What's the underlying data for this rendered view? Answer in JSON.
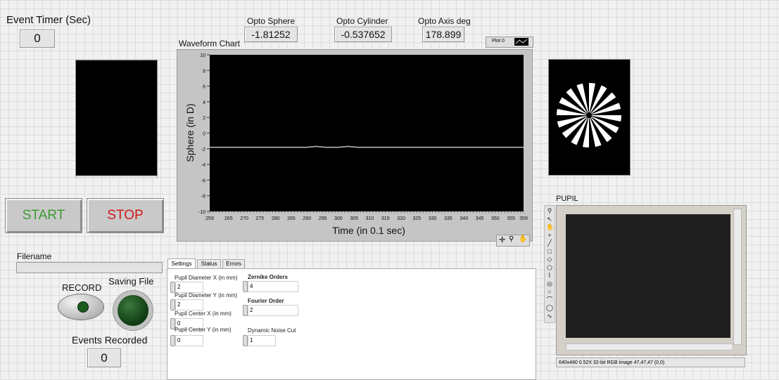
{
  "event_timer": {
    "label": "Event Timer  (Sec)",
    "value": "0"
  },
  "opto": {
    "sphere": {
      "label": "Opto Sphere",
      "value": "-1.81252"
    },
    "cylinder": {
      "label": "Opto Cylinder",
      "value": "-0.537652"
    },
    "axis": {
      "label": "Opto Axis deg",
      "value": "178.899"
    }
  },
  "waveform": {
    "title": "Waveform Chart",
    "legend_label": "Plot 0"
  },
  "buttons": {
    "start": "START",
    "stop": "STOP",
    "record": "RECORD"
  },
  "file": {
    "filename_label": "Filename",
    "filename_value": "",
    "saving_label": "Saving File"
  },
  "events": {
    "label": "Events Recorded",
    "value": "0"
  },
  "tabs": [
    {
      "label": "Settings"
    },
    {
      "label": "Status"
    },
    {
      "label": "Errors"
    }
  ],
  "settings": {
    "pupil_diameter_x": {
      "label": "Pupil Diameter X (in mm)",
      "value": "2"
    },
    "pupil_diameter_y": {
      "label": "Pupil Diameter Y (in mm)",
      "value": "2"
    },
    "pupil_center_x": {
      "label": "Pupil Center X (in mm)",
      "value": "0"
    },
    "pupil_center_y": {
      "label": "Pupil Center Y (in mm)",
      "value": "0"
    },
    "zernike_orders": {
      "label": "Zernike Orders",
      "value": "4"
    },
    "fourier_order": {
      "label": "Fourier Order",
      "value": "2"
    },
    "dynamic_noise_cut": {
      "label": "Dynamic Noise Cut",
      "value": "1"
    }
  },
  "pupil": {
    "label": "PUPIL",
    "status": "640x480 0.52X 32-bit RGB image 47,47,47    (0,0)",
    "tools": [
      "zoom-icon",
      "pointer-icon",
      "hand-icon",
      "point-icon",
      "line-icon",
      "rect-icon",
      "rotated-rect-icon",
      "polygon-icon",
      "freehand-icon",
      "annulus-icon",
      "oval-icon",
      "broken-line-icon",
      "circle-icon",
      "freeline-icon"
    ]
  },
  "colors": {
    "start_text": "#3c9a34",
    "stop_text": "#d01818",
    "trace": "#b0b0b0",
    "record_led": "#1d5a1d"
  },
  "chart_data": {
    "type": "line",
    "title": "",
    "xlabel": "Time (in 0.1 sec)",
    "ylabel": "Sphere (in D)",
    "xlim": [
      259,
      359
    ],
    "ylim": [
      -10,
      10
    ],
    "x_ticks": [
      "259",
      "265",
      "270",
      "275",
      "280",
      "285",
      "290",
      "295",
      "300",
      "305",
      "310",
      "315",
      "320",
      "325",
      "330",
      "335",
      "340",
      "345",
      "350",
      "355",
      "359"
    ],
    "y_ticks": [
      "10",
      "8",
      "6",
      "4",
      "2",
      "0",
      "-2",
      "-4",
      "-6",
      "-8",
      "-10"
    ],
    "series": [
      {
        "name": "Plot 0",
        "x": [
          259,
          290,
          293,
          296,
          300,
          303,
          306,
          359
        ],
        "y": [
          -1.81,
          -1.81,
          -1.7,
          -1.81,
          -1.81,
          -1.7,
          -1.81,
          -1.81
        ]
      }
    ]
  }
}
